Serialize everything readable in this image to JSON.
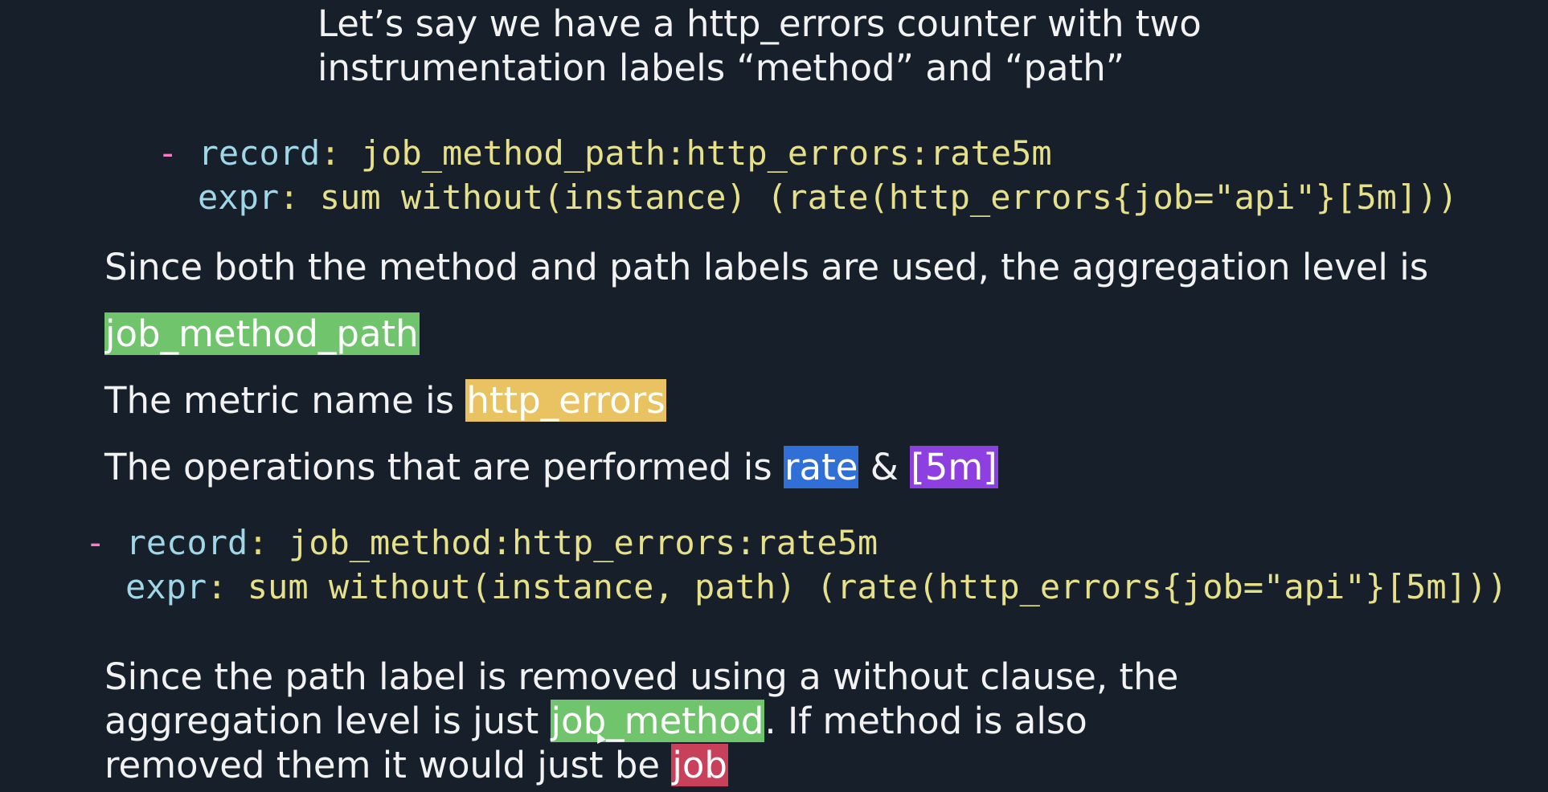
{
  "intro": {
    "line1": "Let’s say we have a http_errors counter with two",
    "line2": "instrumentation labels “method” and “path”"
  },
  "code1": {
    "dash": "-",
    "record_key": "record",
    "expr_key": "expr",
    "colon": ":",
    "record_value": "job_method_path:http_errors:rate5m",
    "expr_value": "sum without(instance) (rate(http_errors{job=\"api\"}[5m]))"
  },
  "explain1": {
    "text": "Since both the method and path labels are used, the aggregation level is",
    "level": "job_method_path"
  },
  "metric": {
    "prefix": "The metric name is ",
    "name": "http_errors"
  },
  "operations": {
    "prefix": "The operations that are performed is ",
    "op1": "rate",
    "amp": " & ",
    "op2": "[5m]"
  },
  "code2": {
    "dash": "-",
    "record_key": "record",
    "expr_key": "expr",
    "colon": ":",
    "record_value": "job_method:http_errors:rate5m",
    "expr_value": "sum without(instance, path) (rate(http_errors{job=\"api\"}[5m]))"
  },
  "explain2": {
    "line1": "Since the path label is removed using a without clause, the",
    "line2_prefix": "aggregation level is just ",
    "line2_level": "job_method",
    "line2_suffix": ". If method is also",
    "line3_prefix": "removed them it would just be ",
    "line3_level": "job"
  },
  "colors": {
    "background": "#17202a",
    "green": "#6fc46c",
    "yellow": "#e9c361",
    "blue": "#2f6fd6",
    "purple": "#8e3fe0",
    "red": "#c9405a"
  }
}
